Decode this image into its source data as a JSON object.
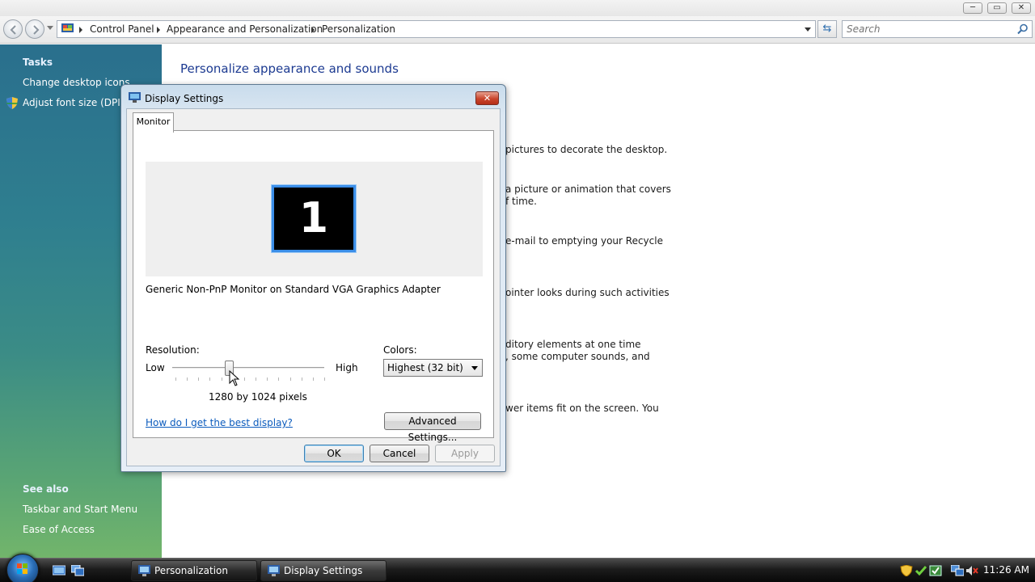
{
  "window": {
    "minimize": "─",
    "maximize": "▭",
    "close": "✕"
  },
  "address": {
    "breadcrumbs": [
      "Control Panel",
      "Appearance and Personalization",
      "Personalization"
    ],
    "search_placeholder": "Search"
  },
  "sidebar": {
    "tasks_heading": "Tasks",
    "tasks": [
      "Change desktop icons",
      "Adjust font size (DPI)"
    ],
    "see_also_heading": "See also",
    "see_also": [
      "Taskbar and Start Menu",
      "Ease of Access"
    ]
  },
  "content": {
    "title": "Personalize appearance and sounds",
    "desc_lines": [
      "pictures to decorate the desktop.",
      "a picture or animation that covers",
      "f time.",
      "e-mail to emptying your Recycle",
      "ointer looks during such activities",
      "ditory elements at one time",
      ", some computer sounds, and",
      "wer items fit on the screen. You"
    ]
  },
  "dialog": {
    "title": "Display Settings",
    "close": "✕",
    "tab": "Monitor",
    "monitor_number": "1",
    "monitor_name": "Generic Non-PnP Monitor on Standard VGA Graphics Adapter",
    "resolution_label": "Resolution:",
    "low_label": "Low",
    "high_label": "High",
    "resolution_value": "1280 by 1024 pixels",
    "resolution_slider_position": 0.38,
    "colors_label": "Colors:",
    "colors_value": "Highest (32 bit)",
    "help_link": "How do I get the best display?",
    "advanced_button": "Advanced Settings...",
    "ok_button": "OK",
    "cancel_button": "Cancel",
    "apply_button": "Apply"
  },
  "taskbar": {
    "buttons": [
      "Personalization",
      "Display Settings"
    ],
    "clock": "11:26 AM"
  },
  "colors": {
    "title_blue": "#1c3a91",
    "link_blue": "#0b5bbd",
    "monitor_border": "#3b8ee8"
  }
}
